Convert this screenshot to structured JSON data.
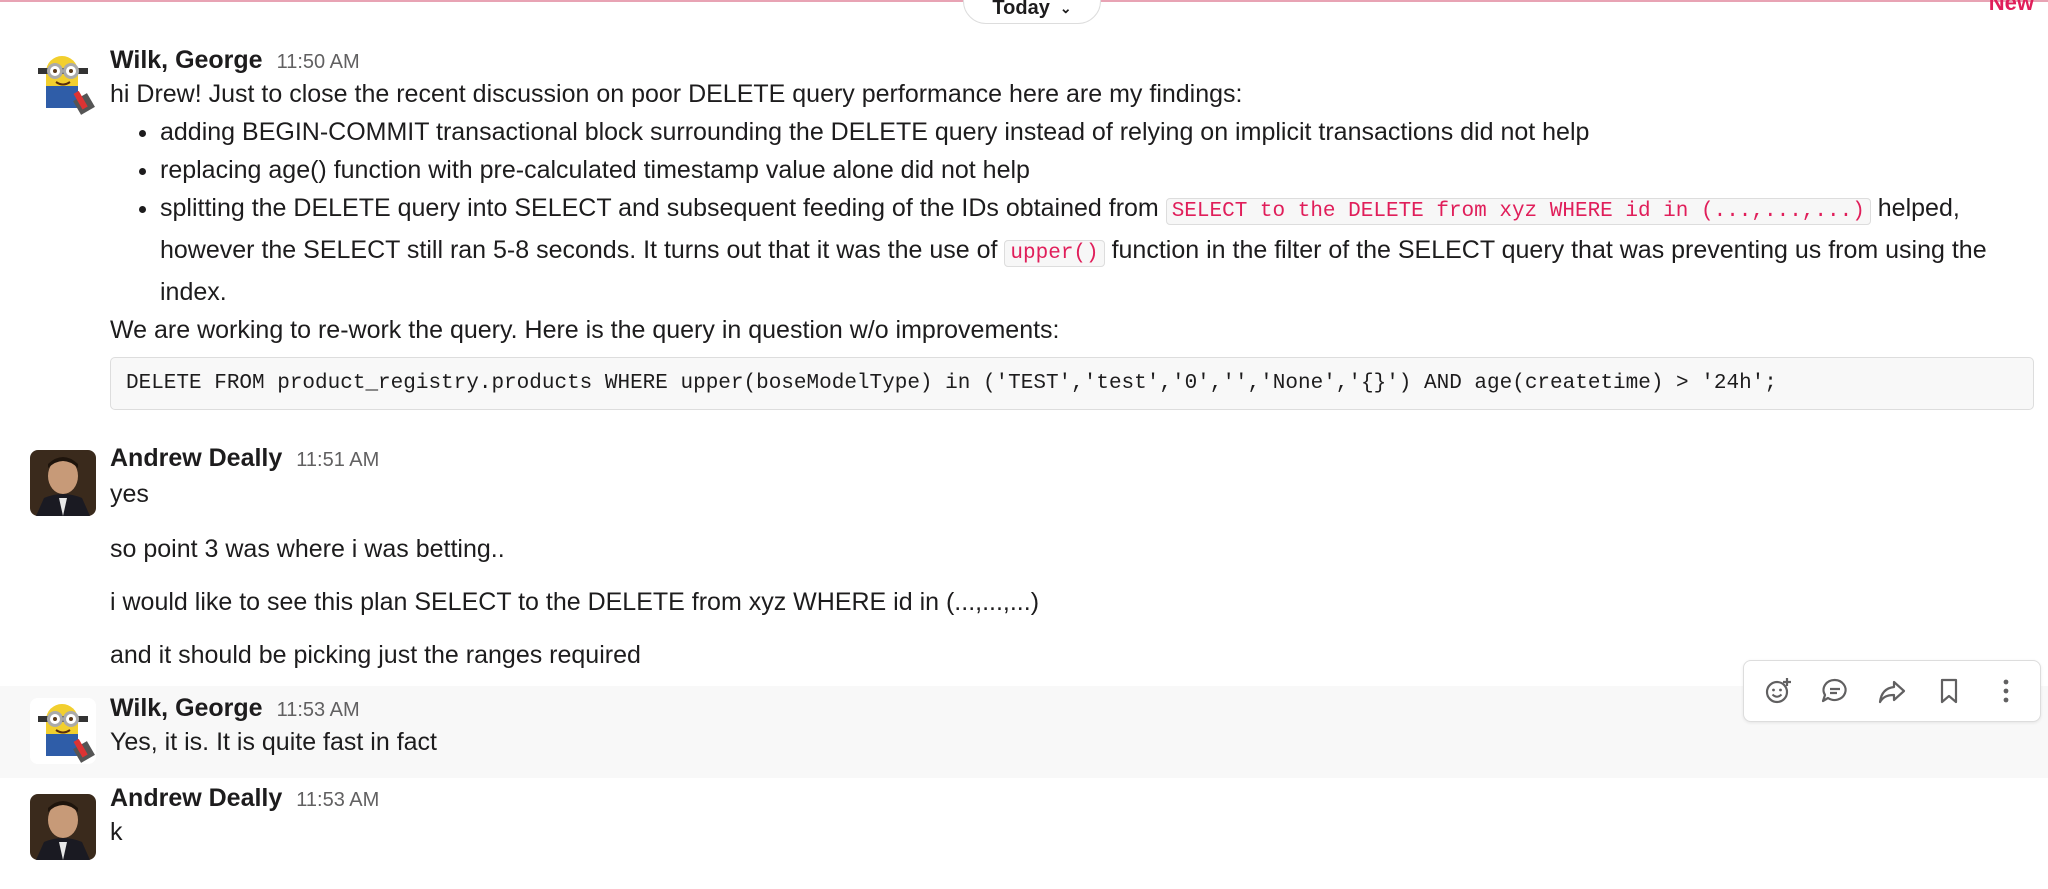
{
  "divider": {
    "day_label": "Today",
    "new_label": "New"
  },
  "messages": [
    {
      "sender": "Wilk, George",
      "time": "11:50 AM",
      "intro": "hi Drew!  Just to close the recent discussion on poor DELETE query performance here are my findings:",
      "bullets": {
        "b1": "adding BEGIN-COMMIT transactional block surrounding the DELETE query instead of relying on implicit transactions did not help",
        "b2": "replacing age() function with pre-calculated timestamp value alone did not help",
        "b3_part1": "splitting the DELETE query into SELECT and subsequent feeding of the IDs obtained from ",
        "b3_code1": "SELECT to the DELETE from xyz WHERE id in (...,...,...)",
        "b3_part2": " helped, however the SELECT still ran 5-8 seconds.  It turns out that it was the use of ",
        "b3_code2": "upper()",
        "b3_part3": " function in the filter of the SELECT query that was preventing us from using the index."
      },
      "outro": "We are working to re-work the query.   Here is the query in question w/o improvements:",
      "code_block": "DELETE FROM product_registry.products WHERE upper(boseModelType) in ('TEST','test','0','','None','{}') AND age(createtime) > '24h';"
    },
    {
      "sender": "Andrew Deally",
      "time": "11:51 AM",
      "lines": [
        "yes",
        "so point 3 was where i was betting..",
        "i would like to see this plan SELECT to the DELETE from xyz WHERE id in (...,...,...)",
        "and it should be picking just the ranges required"
      ]
    },
    {
      "sender": "Wilk, George",
      "time": "11:53 AM",
      "text": "Yes, it is.  It is quite fast in fact"
    },
    {
      "sender": "Andrew Deally",
      "time": "11:53 AM",
      "text": "k"
    }
  ],
  "hover_actions": [
    "add-reaction-icon",
    "reply-in-thread-icon",
    "share-message-icon",
    "save-bookmark-icon",
    "more-actions-icon"
  ],
  "colors": {
    "mention_red": "#e01e5a",
    "divider_pink": "#e8a3b4",
    "hover_bg": "#f8f8f8"
  }
}
